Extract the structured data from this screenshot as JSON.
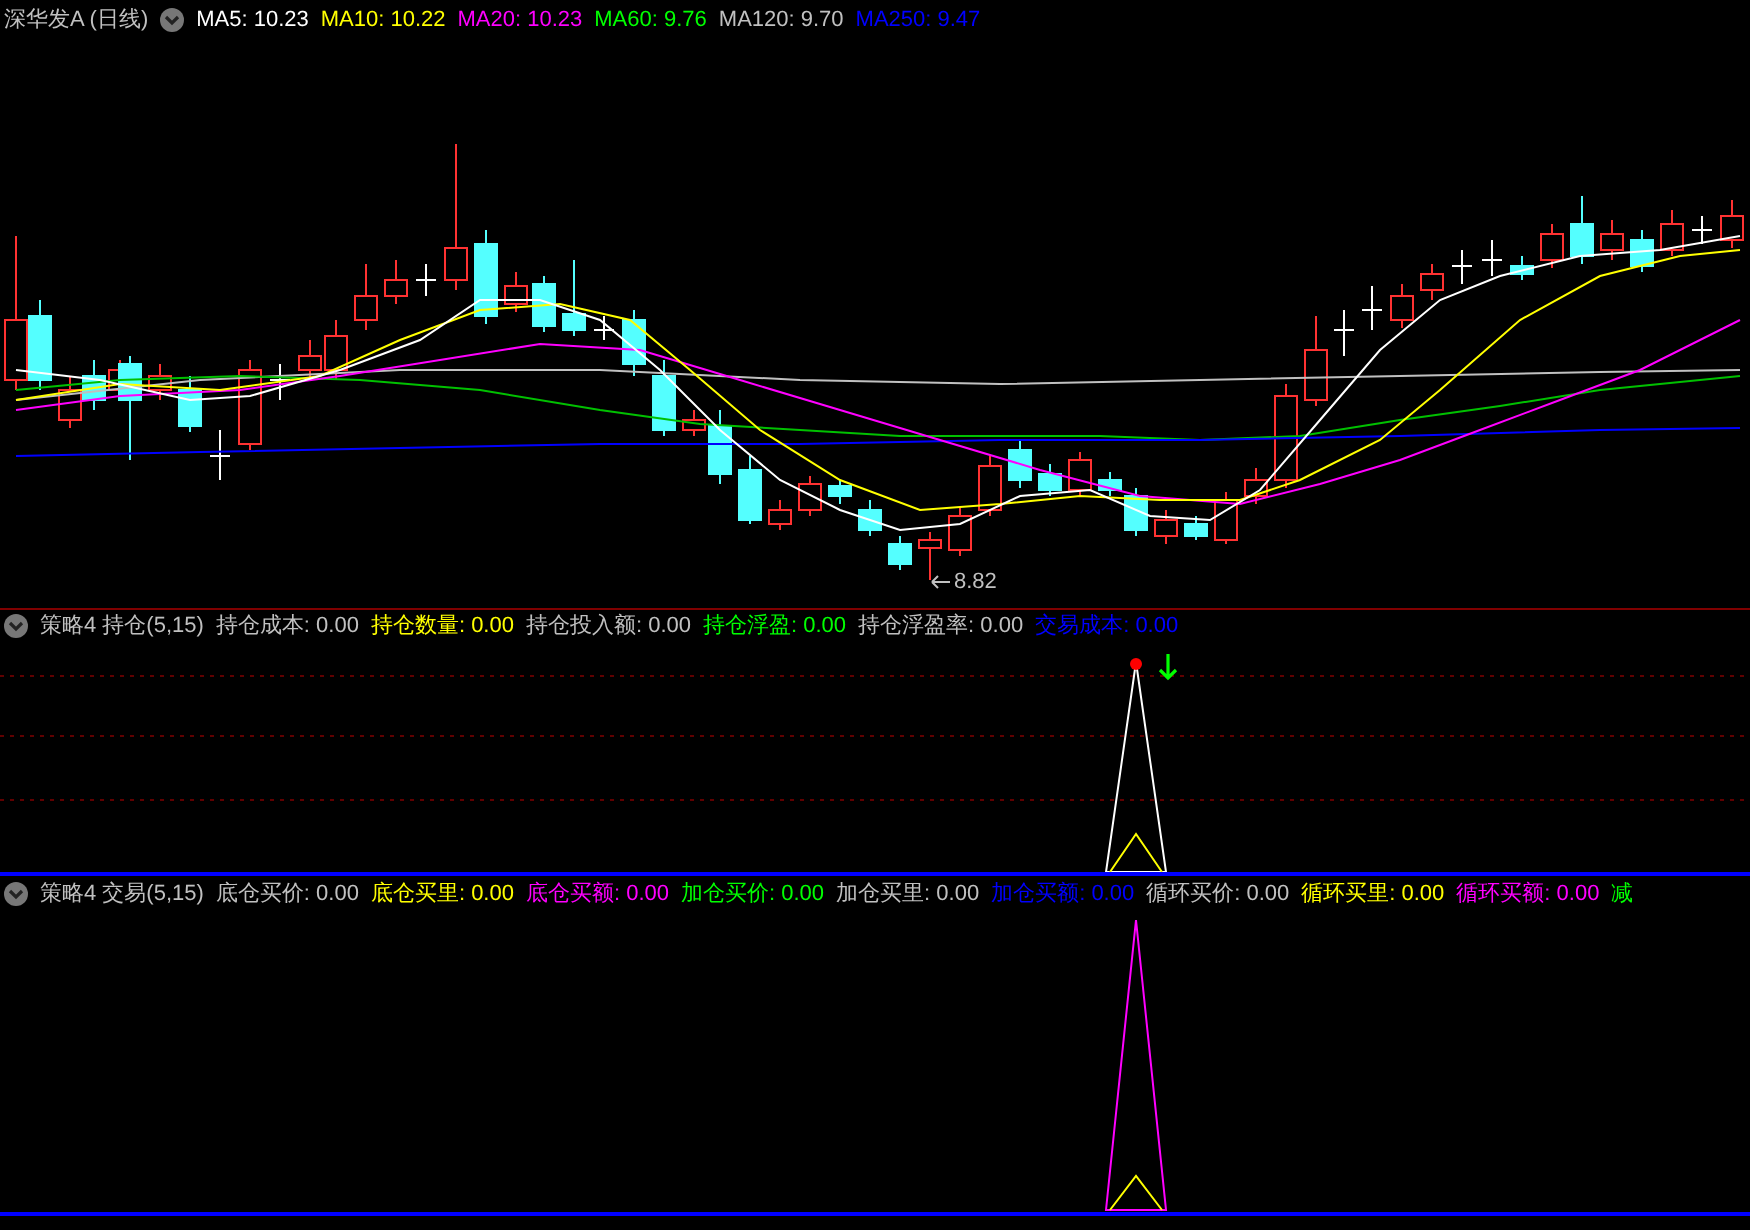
{
  "main_chart": {
    "title": "深华发A (日线)",
    "indicators": [
      {
        "label": "MA5:",
        "value": "10.23",
        "color": "#ffffff"
      },
      {
        "label": "MA10:",
        "value": "10.22",
        "color": "#ffff00"
      },
      {
        "label": "MA20:",
        "value": "10.23",
        "color": "#ff00ff"
      },
      {
        "label": "MA60:",
        "value": "9.76",
        "color": "#00ff00"
      },
      {
        "label": "MA120:",
        "value": "9.70",
        "color": "#c0c0c0"
      },
      {
        "label": "MA250:",
        "value": "9.47",
        "color": "#0000ff"
      }
    ],
    "low_marker": "8.82"
  },
  "position_panel": {
    "title": "策略4 持仓(5,15)",
    "indicators": [
      {
        "label": "持仓成本:",
        "value": "0.00",
        "color": "#c0c0c0"
      },
      {
        "label": "持仓数量:",
        "value": "0.00",
        "color": "#ffff00"
      },
      {
        "label": "持仓投入额:",
        "value": "0.00",
        "color": "#c0c0c0"
      },
      {
        "label": "持仓浮盈:",
        "value": "0.00",
        "color": "#00ff00"
      },
      {
        "label": "持仓浮盈率:",
        "value": "0.00",
        "color": "#c0c0c0"
      },
      {
        "label": "交易成本:",
        "value": "0.00",
        "color": "#0000ff"
      }
    ]
  },
  "trade_panel": {
    "title": "策略4 交易(5,15)",
    "indicators": [
      {
        "label": "底仓买价:",
        "value": "0.00",
        "color": "#c0c0c0"
      },
      {
        "label": "底仓买里:",
        "value": "0.00",
        "color": "#ffff00"
      },
      {
        "label": "底仓买额:",
        "value": "0.00",
        "color": "#ff00ff"
      },
      {
        "label": "加仓买价:",
        "value": "0.00",
        "color": "#00ff00"
      },
      {
        "label": "加仓买里:",
        "value": "0.00",
        "color": "#c0c0c0"
      },
      {
        "label": "加仓买额:",
        "value": "0.00",
        "color": "#0000ff"
      },
      {
        "label": "循环买价:",
        "value": "0.00",
        "color": "#c0c0c0"
      },
      {
        "label": "循环买里:",
        "value": "0.00",
        "color": "#ffff00"
      },
      {
        "label": "循环买额:",
        "value": "0.00",
        "color": "#ff00ff"
      },
      {
        "label": "减",
        "color": "#00ff00"
      }
    ]
  }
}
